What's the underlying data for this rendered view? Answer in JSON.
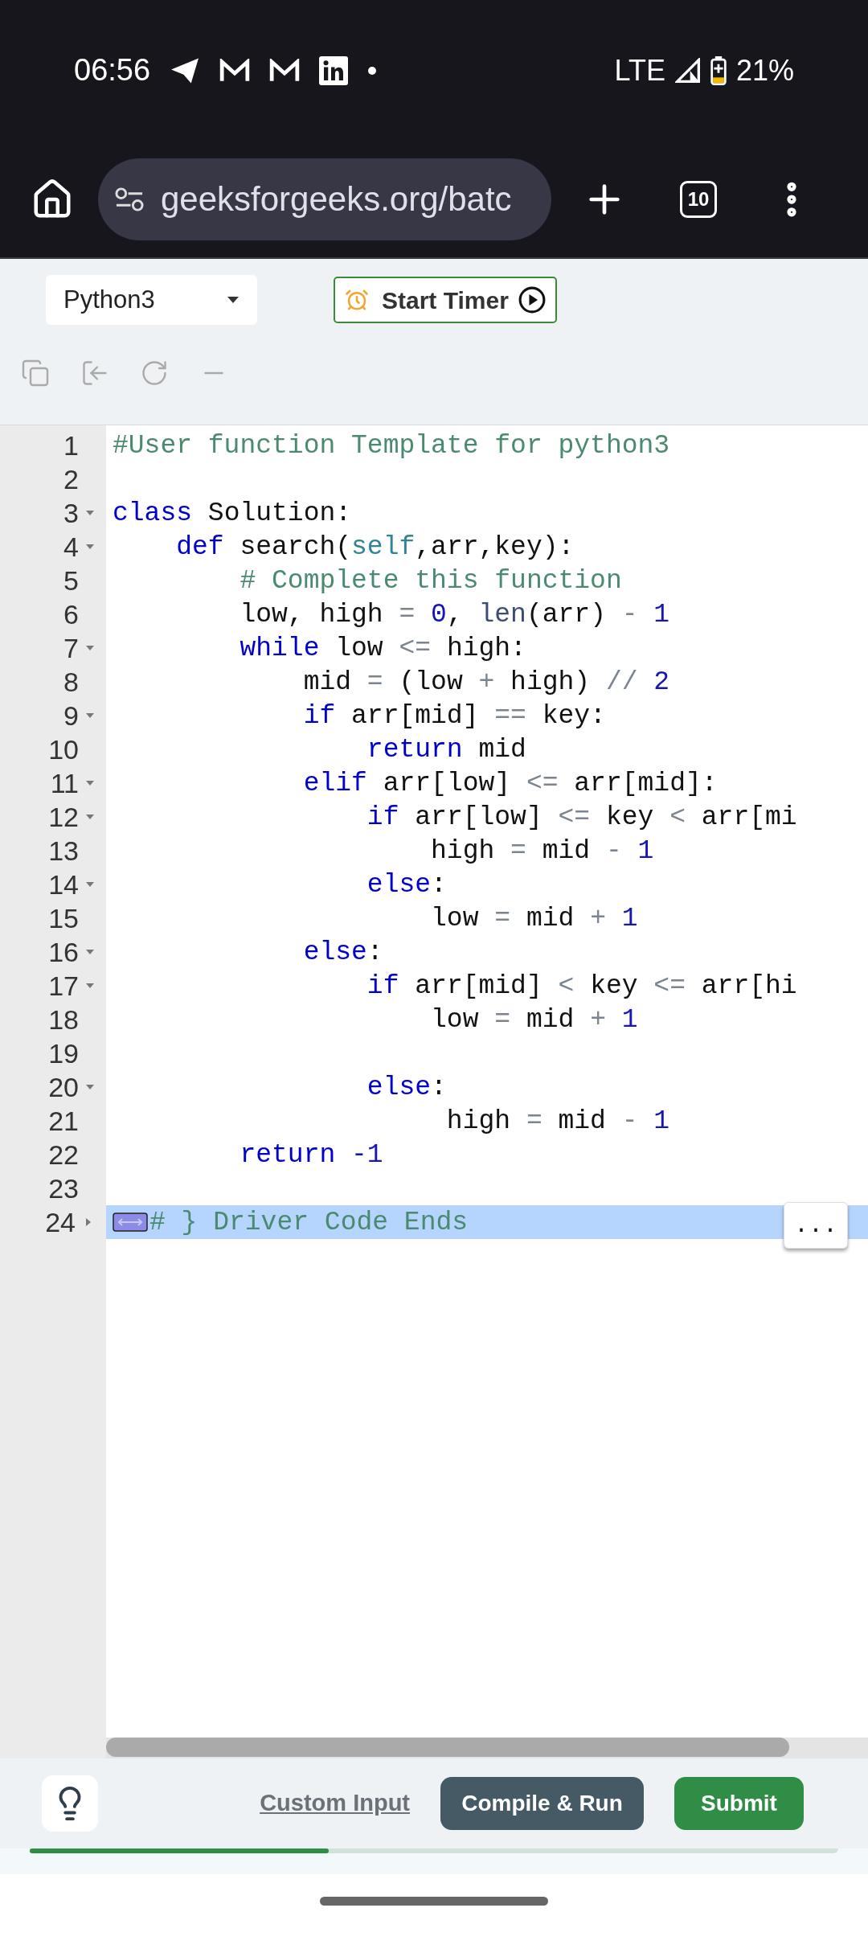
{
  "status_bar": {
    "time": "06:56",
    "network": "LTE",
    "battery": "21%"
  },
  "browser": {
    "url": "geeksforgeeks.org/batc",
    "tab_count": "10"
  },
  "toolbar": {
    "language": "Python3",
    "timer_button": "Start Timer"
  },
  "editor": {
    "lines": [
      {
        "number": "1",
        "tokens": [
          {
            "t": "#User function Template for python3",
            "kind": "comment"
          }
        ]
      },
      {
        "number": "2"
      },
      {
        "number": "3",
        "expanded": true,
        "tokens": [
          {
            "t": "class",
            "kind": "keyword"
          },
          {
            "t": " Solution:",
            "kind": "plain"
          }
        ]
      },
      {
        "number": "4",
        "expanded": true,
        "tokens": [
          {
            "t": "    def",
            "kind": "keyword"
          },
          {
            "t": " search(",
            "kind": "plain"
          },
          {
            "t": "self",
            "kind": "self"
          },
          {
            "t": ",arr,key):",
            "kind": "plain"
          }
        ]
      },
      {
        "number": "5",
        "tokens": [
          {
            "t": "        # Complete this function",
            "kind": "comment"
          }
        ]
      },
      {
        "number": "6",
        "tokens": [
          {
            "t": "        low, high ",
            "kind": "plain"
          },
          {
            "t": "= ",
            "kind": "operator"
          },
          {
            "t": "0",
            "kind": "number"
          },
          {
            "t": ", ",
            "kind": "plain"
          },
          {
            "t": "len",
            "kind": "builtin"
          },
          {
            "t": "(arr) ",
            "kind": "plain"
          },
          {
            "t": "- ",
            "kind": "operator"
          },
          {
            "t": "1",
            "kind": "number"
          }
        ]
      },
      {
        "number": "7",
        "expanded": true,
        "tokens": [
          {
            "t": "        while",
            "kind": "keyword"
          },
          {
            "t": " low ",
            "kind": "plain"
          },
          {
            "t": "<=",
            "kind": "operator"
          },
          {
            "t": " high:",
            "kind": "plain"
          }
        ]
      },
      {
        "number": "8",
        "tokens": [
          {
            "t": "            mid ",
            "kind": "plain"
          },
          {
            "t": "=",
            "kind": "operator"
          },
          {
            "t": " (low ",
            "kind": "plain"
          },
          {
            "t": "+",
            "kind": "operator"
          },
          {
            "t": " high) ",
            "kind": "plain"
          },
          {
            "t": "// ",
            "kind": "operator"
          },
          {
            "t": "2",
            "kind": "number"
          }
        ]
      },
      {
        "number": "9",
        "expanded": true,
        "tokens": [
          {
            "t": "            if",
            "kind": "keyword"
          },
          {
            "t": " arr[mid] ",
            "kind": "plain"
          },
          {
            "t": "==",
            "kind": "operator"
          },
          {
            "t": " key:",
            "kind": "plain"
          }
        ]
      },
      {
        "number": "10",
        "tokens": [
          {
            "t": "                return",
            "kind": "keyword"
          },
          {
            "t": " mid",
            "kind": "plain"
          }
        ]
      },
      {
        "number": "11",
        "expanded": true,
        "tokens": [
          {
            "t": "            elif",
            "kind": "keyword"
          },
          {
            "t": " arr[low] ",
            "kind": "plain"
          },
          {
            "t": "<=",
            "kind": "operator"
          },
          {
            "t": " arr[mid]:",
            "kind": "plain"
          }
        ]
      },
      {
        "number": "12",
        "expanded": true,
        "tokens": [
          {
            "t": "                if",
            "kind": "keyword"
          },
          {
            "t": " arr[low] ",
            "kind": "plain"
          },
          {
            "t": "<=",
            "kind": "operator"
          },
          {
            "t": " key ",
            "kind": "plain"
          },
          {
            "t": "<",
            "kind": "operator"
          },
          {
            "t": " arr[mi",
            "kind": "plain"
          }
        ]
      },
      {
        "number": "13",
        "tokens": [
          {
            "t": "                    high ",
            "kind": "plain"
          },
          {
            "t": "=",
            "kind": "operator"
          },
          {
            "t": " mid ",
            "kind": "plain"
          },
          {
            "t": "- ",
            "kind": "operator"
          },
          {
            "t": "1",
            "kind": "number"
          }
        ]
      },
      {
        "number": "14",
        "expanded": true,
        "tokens": [
          {
            "t": "                else",
            "kind": "keyword"
          },
          {
            "t": ":",
            "kind": "plain"
          }
        ]
      },
      {
        "number": "15",
        "tokens": [
          {
            "t": "                    low ",
            "kind": "plain"
          },
          {
            "t": "=",
            "kind": "operator"
          },
          {
            "t": " mid ",
            "kind": "plain"
          },
          {
            "t": "+ ",
            "kind": "operator"
          },
          {
            "t": "1",
            "kind": "number"
          }
        ]
      },
      {
        "number": "16",
        "expanded": true,
        "tokens": [
          {
            "t": "            else",
            "kind": "keyword"
          },
          {
            "t": ":",
            "kind": "plain"
          }
        ]
      },
      {
        "number": "17",
        "expanded": true,
        "tokens": [
          {
            "t": "                if",
            "kind": "keyword"
          },
          {
            "t": " arr[mid] ",
            "kind": "plain"
          },
          {
            "t": "<",
            "kind": "operator"
          },
          {
            "t": " key ",
            "kind": "plain"
          },
          {
            "t": "<=",
            "kind": "operator"
          },
          {
            "t": " arr[hi",
            "kind": "plain"
          }
        ]
      },
      {
        "number": "18",
        "tokens": [
          {
            "t": "                    low ",
            "kind": "plain"
          },
          {
            "t": "=",
            "kind": "operator"
          },
          {
            "t": " mid ",
            "kind": "plain"
          },
          {
            "t": "+ ",
            "kind": "operator"
          },
          {
            "t": "1",
            "kind": "number"
          }
        ]
      },
      {
        "number": "19"
      },
      {
        "number": "20",
        "expanded": true,
        "tokens": [
          {
            "t": "                else",
            "kind": "keyword"
          },
          {
            "t": ":",
            "kind": "plain"
          }
        ]
      },
      {
        "number": "21",
        "tokens": [
          {
            "t": "                     high ",
            "kind": "plain"
          },
          {
            "t": "=",
            "kind": "operator"
          },
          {
            "t": " mid ",
            "kind": "plain"
          },
          {
            "t": "- ",
            "kind": "operator"
          },
          {
            "t": "1",
            "kind": "number"
          }
        ]
      },
      {
        "number": "22",
        "tokens": [
          {
            "t": "        return",
            "kind": "keyword"
          },
          {
            "t": " -1",
            "kind": "number"
          }
        ]
      },
      {
        "number": "23"
      },
      {
        "number": "24",
        "expanded": false,
        "selected": true,
        "tokens": [
          {
            "t": "# } Driver Code Ends",
            "kind": "comment"
          }
        ]
      }
    ],
    "more_button": "..."
  },
  "actions": {
    "custom_input": "Custom Input",
    "compile_button": "Compile & Run",
    "submit_button": "Submit",
    "progress": {
      "level": 0.37
    }
  }
}
